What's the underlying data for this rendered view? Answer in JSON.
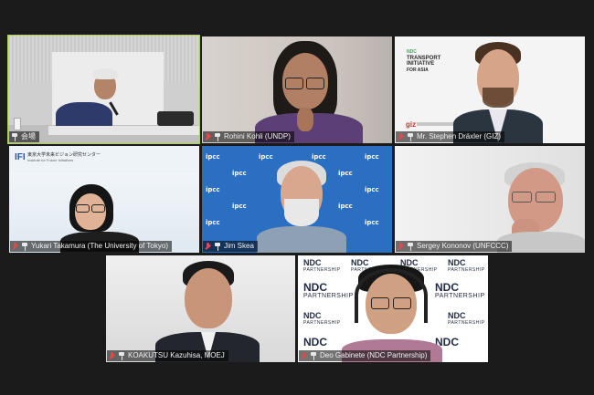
{
  "tiles": [
    {
      "name": "会場",
      "active": true
    },
    {
      "name": "Rohini Kohli (UNDP)"
    },
    {
      "name": "Mr. Stephen Dräxler (GIZ)"
    },
    {
      "name": "Yukari Takamura (The University of Tokyo)"
    },
    {
      "name": "Jim Skea"
    },
    {
      "name": "Sergey Kononov (UNFCCC)"
    },
    {
      "name": "KOAKUTSU Kazuhisa, MOEJ"
    },
    {
      "name": "Deo Gabinete (NDC Partnership)"
    }
  ],
  "backgrounds": {
    "transport_logo": [
      "NDC",
      "TRANSPORT",
      "INITIATIVE",
      "FOR ASIA"
    ],
    "transport_sponsor": "giz",
    "utokyo_logo_mark": "IFI",
    "utokyo_logo_text": "東京大学未来ビジョン研究センター",
    "utokyo_logo_sub": "Institute for Future Initiatives",
    "ipcc_word": "ipcc",
    "ndc_word": "NDC",
    "ndc_sub": "PARTNERSHIP"
  },
  "colors": {
    "active_border": "#a7d34a",
    "muted_mic": "#e24a4a",
    "ipcc_blue": "#2a6fc2"
  }
}
